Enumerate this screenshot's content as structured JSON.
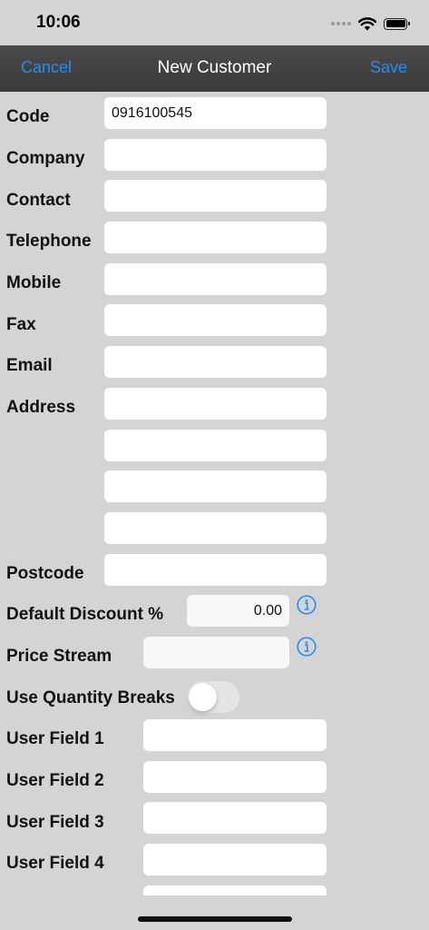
{
  "status_bar": {
    "time": "10:06"
  },
  "nav": {
    "cancel_label": "Cancel",
    "title": "New Customer",
    "save_label": "Save"
  },
  "form": {
    "code": {
      "label": "Code",
      "value": "0916100545"
    },
    "company": {
      "label": "Company",
      "value": ""
    },
    "contact": {
      "label": "Contact",
      "value": ""
    },
    "telephone": {
      "label": "Telephone",
      "value": ""
    },
    "mobile": {
      "label": "Mobile",
      "value": ""
    },
    "fax": {
      "label": "Fax",
      "value": ""
    },
    "email": {
      "label": "Email",
      "value": ""
    },
    "address": {
      "label": "Address",
      "lines": [
        "",
        "",
        "",
        ""
      ]
    },
    "postcode": {
      "label": "Postcode",
      "value": ""
    },
    "default_discount": {
      "label": "Default Discount %",
      "value": "0.00"
    },
    "price_stream": {
      "label": "Price Stream",
      "value": ""
    },
    "use_quantity_breaks": {
      "label": "Use Quantity Breaks",
      "enabled": false
    },
    "user_field_1": {
      "label": "User Field 1",
      "value": ""
    },
    "user_field_2": {
      "label": "User Field 2",
      "value": ""
    },
    "user_field_3": {
      "label": "User Field 3",
      "value": ""
    },
    "user_field_4": {
      "label": "User Field 4",
      "value": ""
    },
    "user_field_5": {
      "value": ""
    }
  },
  "colors": {
    "accent": "#2d8cf0",
    "nav_bg": "#3f3f3f",
    "page_bg": "#d4d4d4"
  },
  "icons": {
    "info": "info-circle-icon",
    "wifi": "wifi-icon",
    "battery": "battery-icon"
  }
}
